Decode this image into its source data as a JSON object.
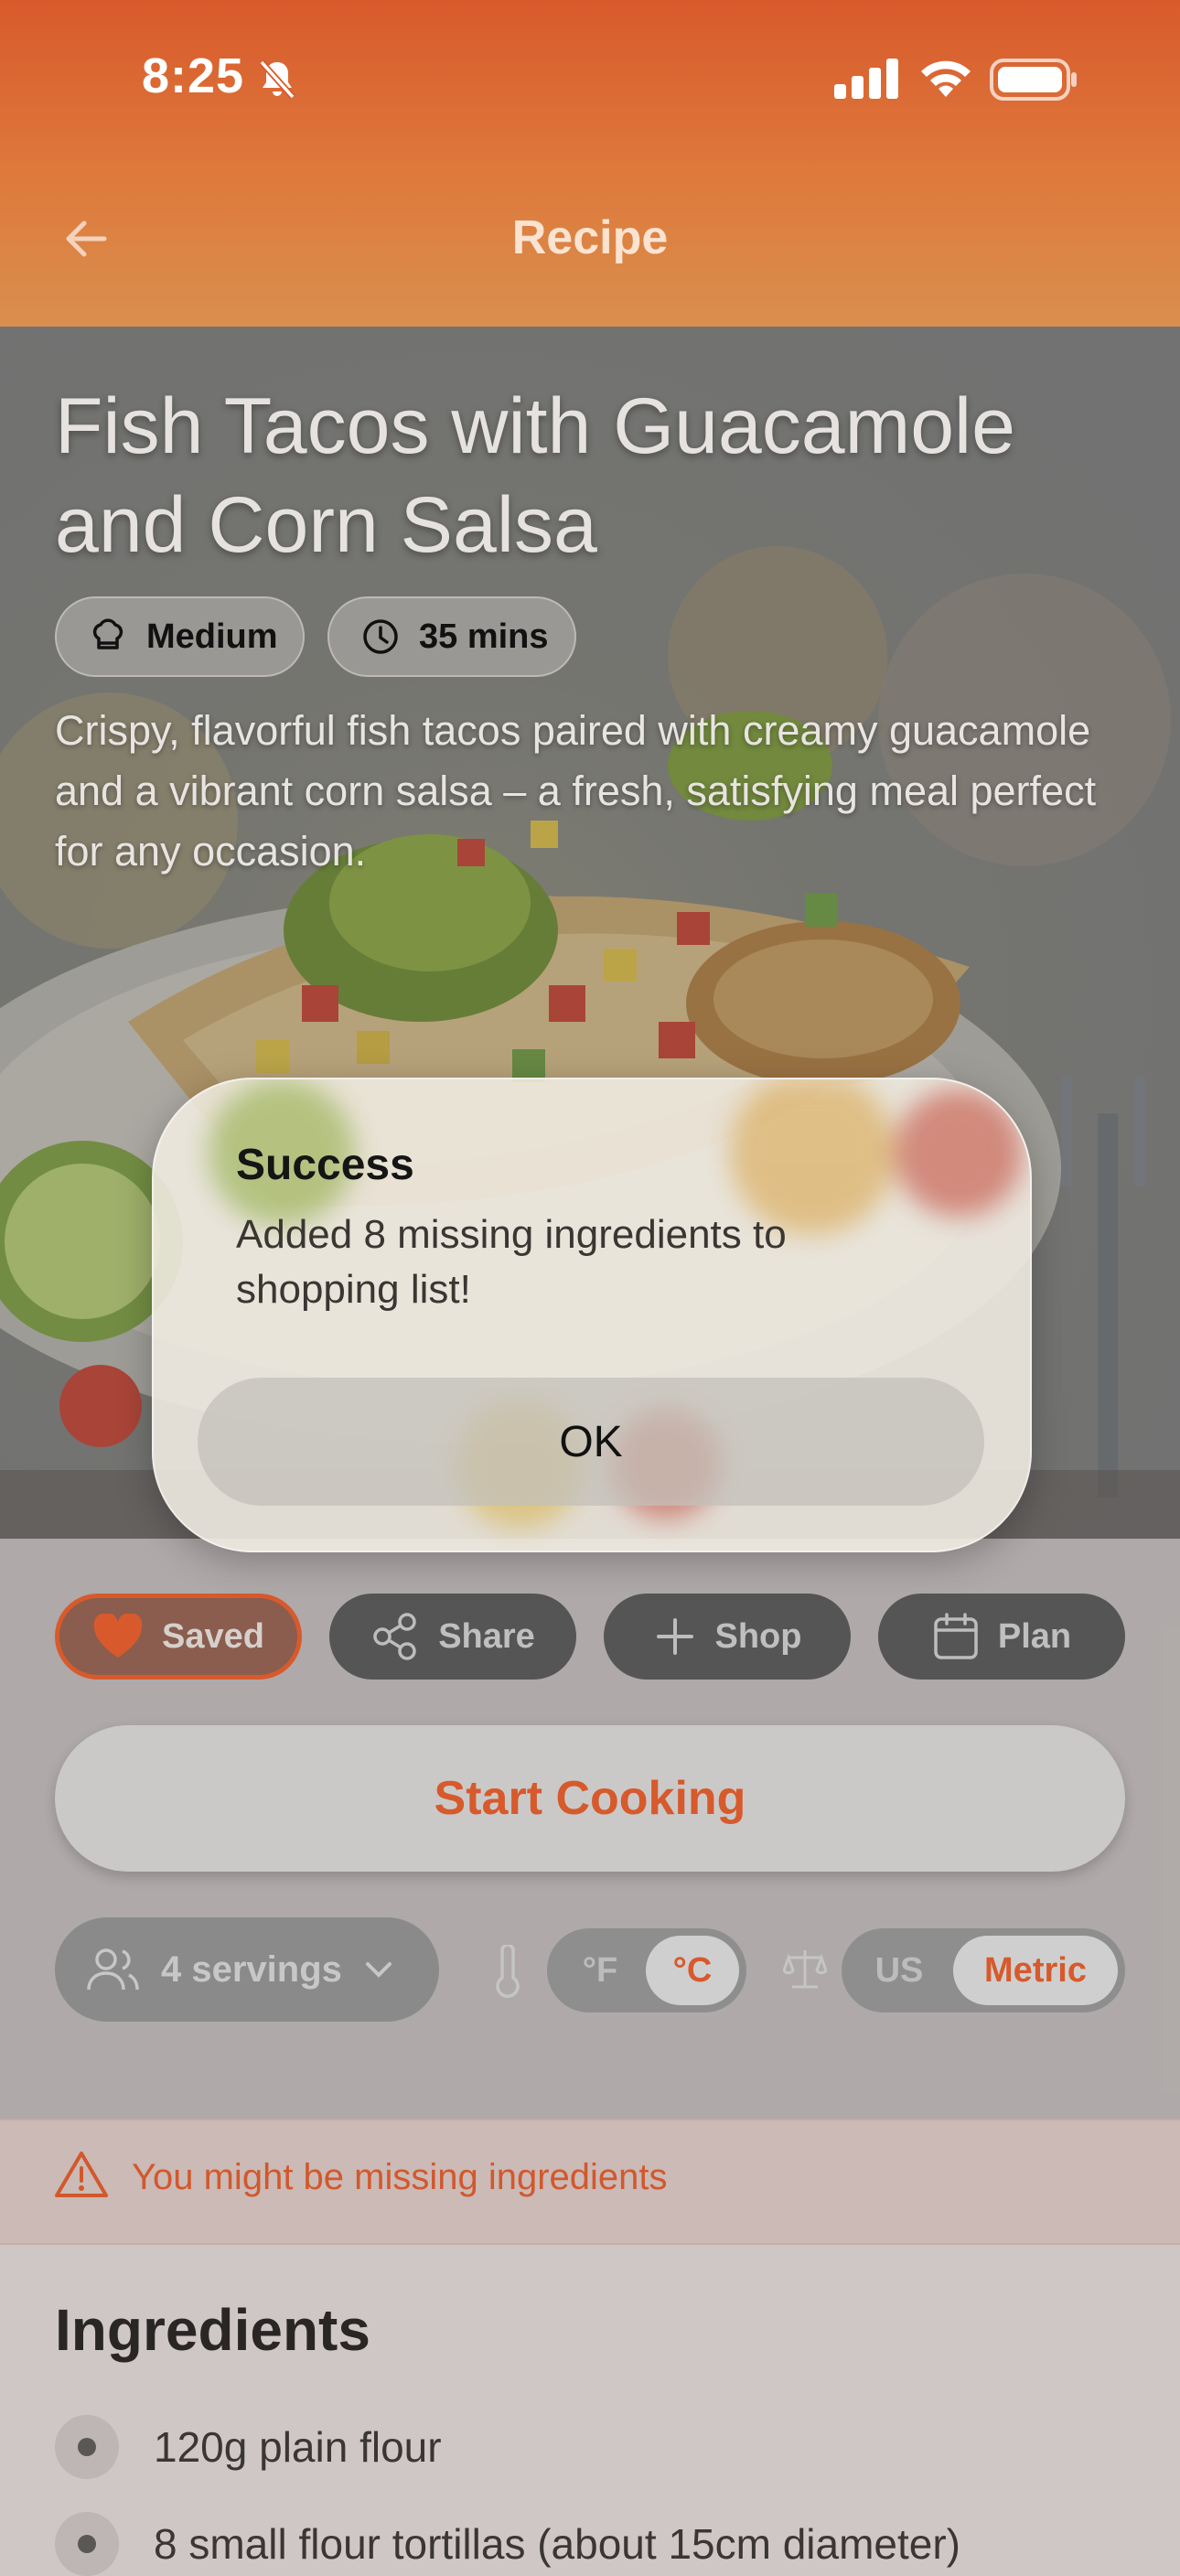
{
  "status_bar": {
    "time": "8:25"
  },
  "nav": {
    "title": "Recipe"
  },
  "recipe": {
    "title": "Fish Tacos with Guacamole and Corn Salsa",
    "difficulty": "Medium",
    "duration": "35 mins",
    "description": "Crispy, flavorful fish tacos paired with creamy guacamole and a vibrant corn salsa – a fresh, satisfying meal perfect for any occasion."
  },
  "actions": {
    "saved": "Saved",
    "share": "Share",
    "shop": "Shop",
    "plan": "Plan",
    "start_cooking": "Start Cooking"
  },
  "settings": {
    "servings": "4 servings",
    "temp_f": "°F",
    "temp_c": "°C",
    "temp_selected": "°C",
    "unit_us": "US",
    "unit_metric": "Metric",
    "unit_selected": "Metric"
  },
  "warning": {
    "text": "You might be missing ingredients"
  },
  "ingredients": {
    "title": "Ingredients",
    "items": [
      "120g plain flour",
      "8 small flour tortillas (about 15cm diameter)"
    ]
  },
  "modal": {
    "title": "Success",
    "message": "Added 8 missing ingredients to shopping list!",
    "ok": "OK"
  },
  "colors": {
    "accent": "#d65a2c",
    "header_top": "#d85a2c",
    "header_bottom": "#d98f4e"
  },
  "icons": [
    "bell-slash-icon",
    "signal-icon",
    "wifi-icon",
    "battery-icon",
    "back-arrow-icon",
    "chef-hat-icon",
    "clock-icon",
    "heart-icon",
    "share-icon",
    "plus-icon",
    "calendar-icon",
    "users-icon",
    "chevron-down-icon",
    "thermometer-icon",
    "scale-icon",
    "warning-icon"
  ]
}
